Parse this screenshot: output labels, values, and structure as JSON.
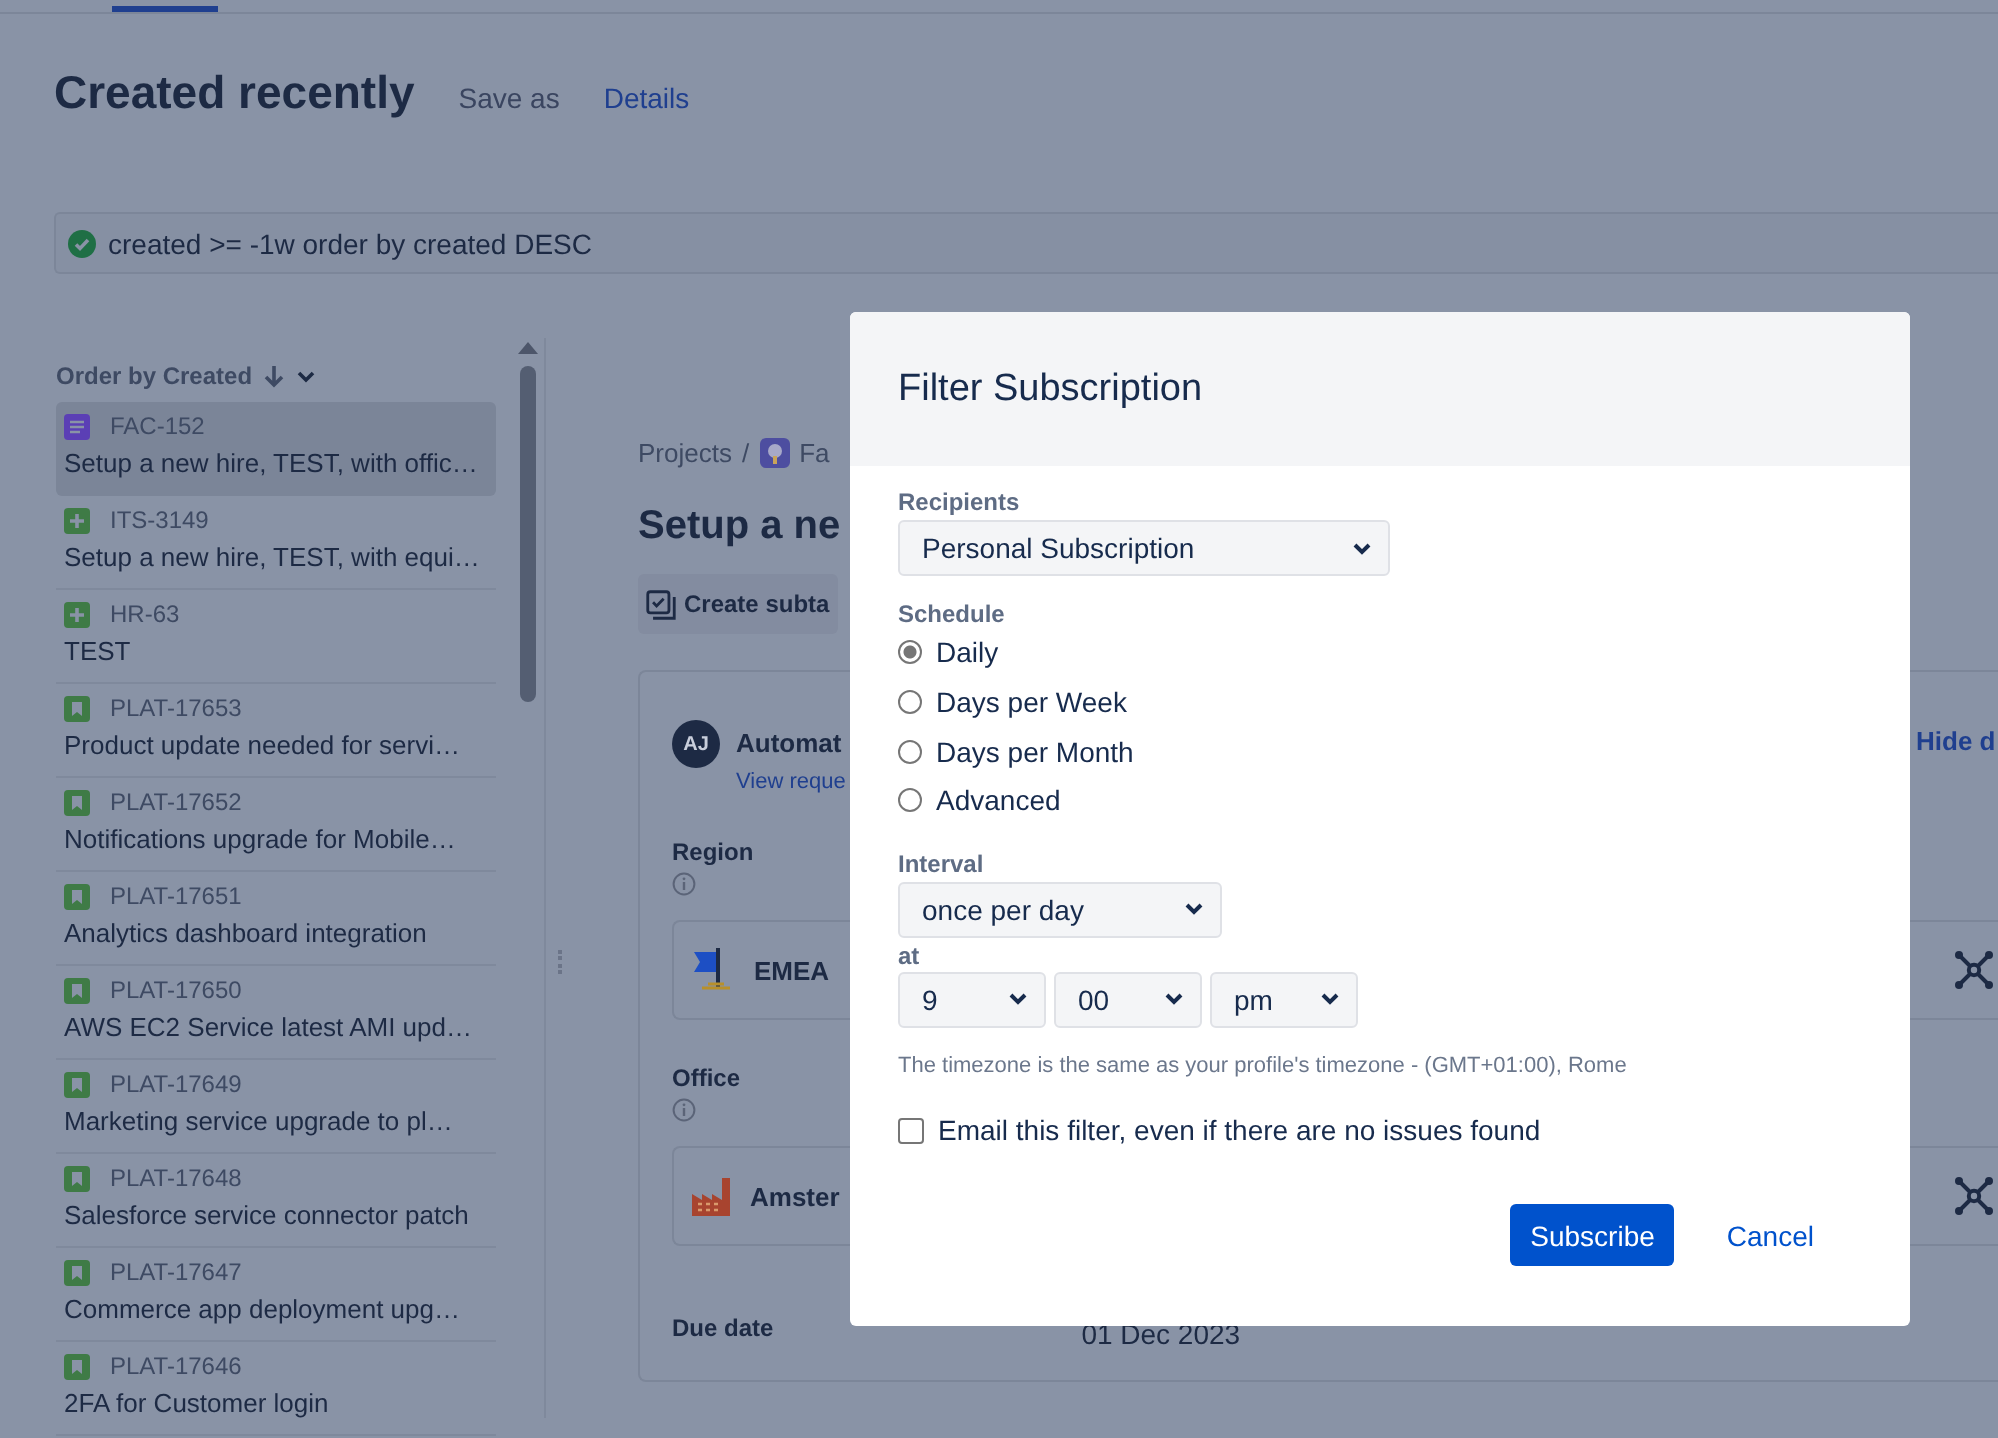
{
  "header": {
    "title": "Created recently",
    "actions": [
      {
        "label": "Save as",
        "kind": "plain"
      },
      {
        "label": "Details",
        "kind": "link"
      }
    ]
  },
  "query": {
    "text": "created >= -1w order by created DESC",
    "valid": true
  },
  "sidebar": {
    "order_label": "Order by Created",
    "items": [
      {
        "key": "FAC-152",
        "summary": "Setup a new hire, TEST, with offic…",
        "kind": "document",
        "selected": true
      },
      {
        "key": "ITS-3149",
        "summary": "Setup a new hire, TEST, with equi…",
        "kind": "plus",
        "selected": false
      },
      {
        "key": "HR-63",
        "summary": "TEST",
        "kind": "plus",
        "selected": false
      },
      {
        "key": "PLAT-17653",
        "summary": "Product update needed for servi…",
        "kind": "bookmark",
        "selected": false
      },
      {
        "key": "PLAT-17652",
        "summary": "Notifications upgrade for Mobile…",
        "kind": "bookmark",
        "selected": false
      },
      {
        "key": "PLAT-17651",
        "summary": "Analytics dashboard integration",
        "kind": "bookmark",
        "selected": false
      },
      {
        "key": "PLAT-17650",
        "summary": "AWS EC2 Service latest AMI upd…",
        "kind": "bookmark",
        "selected": false
      },
      {
        "key": "PLAT-17649",
        "summary": "Marketing service upgrade to pl…",
        "kind": "bookmark",
        "selected": false
      },
      {
        "key": "PLAT-17648",
        "summary": "Salesforce service connector patch",
        "kind": "bookmark",
        "selected": false
      },
      {
        "key": "PLAT-17647",
        "summary": "Commerce app deployment upg…",
        "kind": "bookmark",
        "selected": false
      },
      {
        "key": "PLAT-17646",
        "summary": "2FA for Customer login",
        "kind": "bookmark",
        "selected": false
      }
    ]
  },
  "issue": {
    "breadcrumb": [
      "Projects",
      "Fa"
    ],
    "breadcrumb_separator": "/",
    "title": "Setup a ne",
    "create_subtask": "Create subta",
    "requester": {
      "initials": "AJ",
      "name": "Automat",
      "link": "View reque"
    },
    "hide_link": "Hide d",
    "fields": [
      {
        "label": "Region",
        "value": "EMEA",
        "kind": "flag"
      },
      {
        "label": "Office",
        "value": "Amster",
        "kind": "factory"
      }
    ],
    "due": {
      "label": "Due date",
      "value": "01 Dec 2023"
    }
  },
  "dialog": {
    "title": "Filter Subscription",
    "recipients_label": "Recipients",
    "recipients": "Personal Subscription",
    "schedule_label": "Schedule",
    "schedule": [
      {
        "label": "Daily",
        "selected": true
      },
      {
        "label": "Days per Week",
        "selected": false
      },
      {
        "label": "Days per Month",
        "selected": false
      },
      {
        "label": "Advanced",
        "selected": false
      }
    ],
    "interval_label": "Interval",
    "interval": "once per day",
    "at_label": "at",
    "hour": "9",
    "minute": "00",
    "meridiem": "pm",
    "timezone_note": "The timezone is the same as your profile's timezone - (GMT+01:00), Rome",
    "email_empty": {
      "label": "Email this filter, even if there are no issues found",
      "checked": false
    },
    "buttons": [
      {
        "label": "Subscribe",
        "kind": "primary"
      },
      {
        "label": "Cancel",
        "kind": "link"
      }
    ]
  }
}
